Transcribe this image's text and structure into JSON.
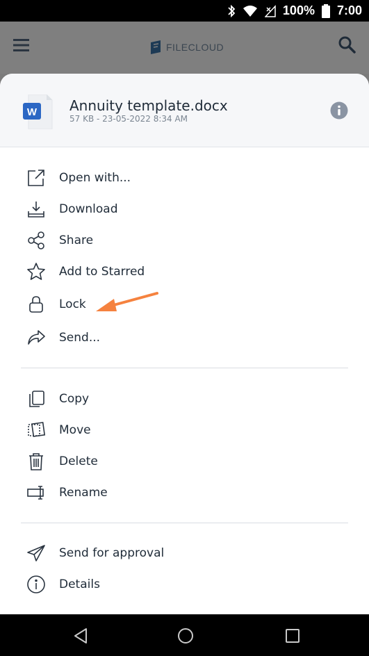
{
  "status_bar": {
    "battery_text": "100%",
    "time": "7:00"
  },
  "app_bar": {
    "logo_text": "FILECLOUD"
  },
  "file": {
    "name": "Annuity template.docx",
    "meta": "57 KB - 23-05-2022 8:34 AM",
    "type_letter": "W"
  },
  "menu": {
    "group1": [
      {
        "label": "Open with...",
        "icon": "open-with-icon"
      },
      {
        "label": "Download",
        "icon": "download-icon"
      },
      {
        "label": "Share",
        "icon": "share-icon"
      },
      {
        "label": "Add to Starred",
        "icon": "star-icon"
      },
      {
        "label": "Lock",
        "icon": "lock-icon"
      },
      {
        "label": "Send...",
        "icon": "send-icon"
      }
    ],
    "group2": [
      {
        "label": "Copy",
        "icon": "copy-icon"
      },
      {
        "label": "Move",
        "icon": "move-icon"
      },
      {
        "label": "Delete",
        "icon": "trash-icon"
      },
      {
        "label": "Rename",
        "icon": "rename-icon"
      }
    ],
    "group3": [
      {
        "label": "Send for approval",
        "icon": "paper-plane-icon"
      },
      {
        "label": "Details",
        "icon": "info-circle-icon"
      }
    ]
  },
  "colors": {
    "accent_arrow": "#f5823f",
    "word_blue": "#2b67c4"
  }
}
